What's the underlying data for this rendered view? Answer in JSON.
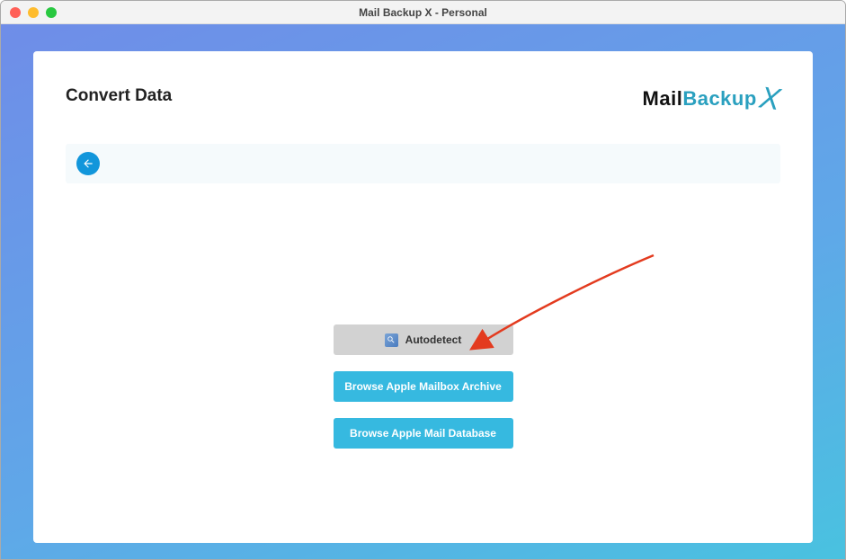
{
  "window": {
    "title": "Mail Backup X - Personal"
  },
  "header": {
    "page_title": "Convert Data",
    "logo_a": "Mail",
    "logo_b": "Backup",
    "logo_c": "X"
  },
  "back_button": {
    "name": "back"
  },
  "options": {
    "autodetect_label": "Autodetect",
    "browse_archive_label": "Browse Apple Mailbox Archive",
    "browse_database_label": "Browse Apple Mail Database"
  },
  "colors": {
    "accent": "#36b9e0",
    "back_button": "#1296db",
    "gradient_top": "#6f8de8",
    "gradient_bottom": "#49c2e0",
    "annotation_arrow": "#e33b1f"
  }
}
